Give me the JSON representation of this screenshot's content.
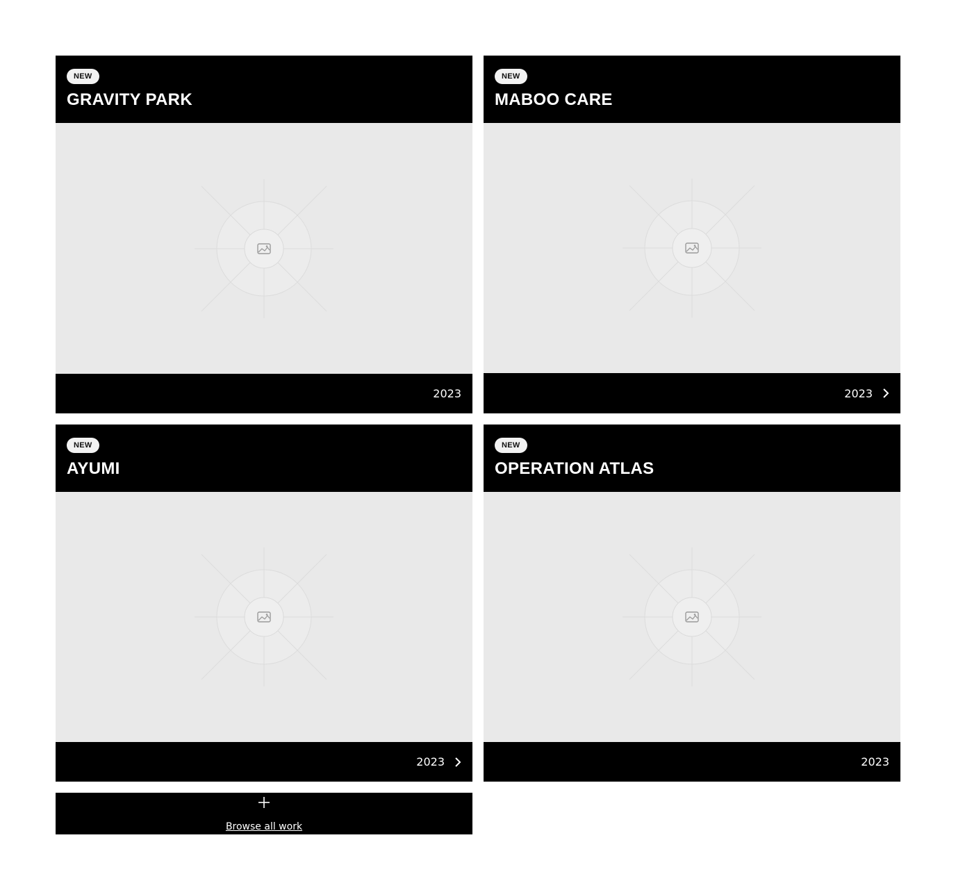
{
  "projects": [
    {
      "badge": "NEW",
      "title": "GRAVITY PARK",
      "year": "2023",
      "has_arrow": false
    },
    {
      "badge": "NEW",
      "title": "MABOO CARE",
      "year": "2023",
      "has_arrow": true
    },
    {
      "badge": "NEW",
      "title": "AYUMI",
      "year": "2023",
      "has_arrow": true
    },
    {
      "badge": "NEW",
      "title": "OPERATION ATLAS",
      "year": "2023",
      "has_arrow": false
    }
  ],
  "browse": {
    "label": "Browse all work",
    "icon": "plus-icon"
  },
  "colors": {
    "card_bg": "#000000",
    "media_bg": "#e9e9e9",
    "badge_bg": "#f2f2f2",
    "text": "#ffffff"
  }
}
